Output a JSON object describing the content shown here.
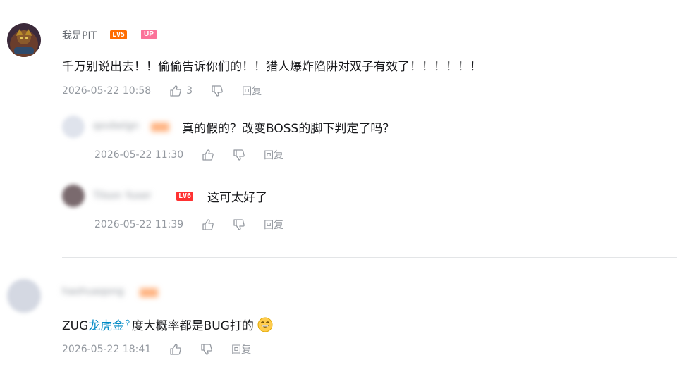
{
  "comments": [
    {
      "username": "我是PIT",
      "level": "LV5",
      "up_badge": "UP",
      "text": "千万别说出去！！偷偷告诉你们的！！猎人爆炸陷阱对双子有效了！！！！！！",
      "time": "2026-05-22 10:58",
      "likes": "3",
      "reply_label": "回复",
      "replies": [
        {
          "username": "qovbelgn",
          "text": "真的假的？改变BOSS的脚下判定了吗？",
          "time": "2026-05-22 11:30",
          "reply_label": "回复"
        },
        {
          "username": "Tilson Yuser",
          "level": "LV6",
          "text": "这可太好了",
          "time": "2026-05-22 11:39",
          "reply_label": "回复"
        }
      ]
    },
    {
      "username": "haohuaqong",
      "text_before": "ZUG",
      "link_text": "龙虎金",
      "text_after": "度大概率都是BUG打的",
      "emoji": "grinning-face",
      "time": "2026-05-22 18:41",
      "reply_label": "回复"
    }
  ],
  "colors": {
    "accent_link": "#008ac5",
    "up_badge": "#fb7299",
    "lv5": "#ff6c00",
    "lv6": "#ff3131",
    "meta_text": "#9499a0"
  }
}
